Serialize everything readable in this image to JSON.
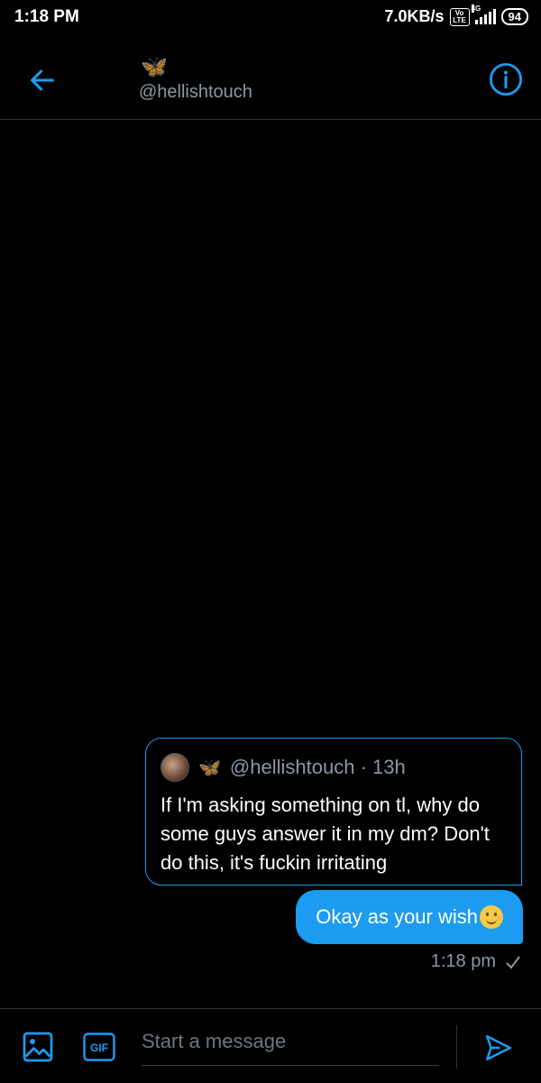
{
  "status_bar": {
    "time": "1:18 PM",
    "net_speed": "7.0KB/s",
    "volte_label": "Vo LTE",
    "network_type": "4G",
    "battery": "94"
  },
  "header": {
    "name_emoji": "🦋",
    "handle": "@hellishtouch"
  },
  "quoted_tweet": {
    "emoji": "🦋",
    "handle": "@hellishtouch",
    "time_ago": "· 13h",
    "text": "If I'm asking something on tl, why do some guys answer it in my dm? Don't do this, it's fuckin irritating"
  },
  "message": {
    "text": "Okay as your wish",
    "timestamp": "1:18 pm",
    "status_icon": "check-icon"
  },
  "composer": {
    "placeholder": "Start a message",
    "gif_label": "GIF"
  },
  "colors": {
    "accent": "#1d9bf0",
    "background": "#000000",
    "muted": "#8b98a5"
  }
}
